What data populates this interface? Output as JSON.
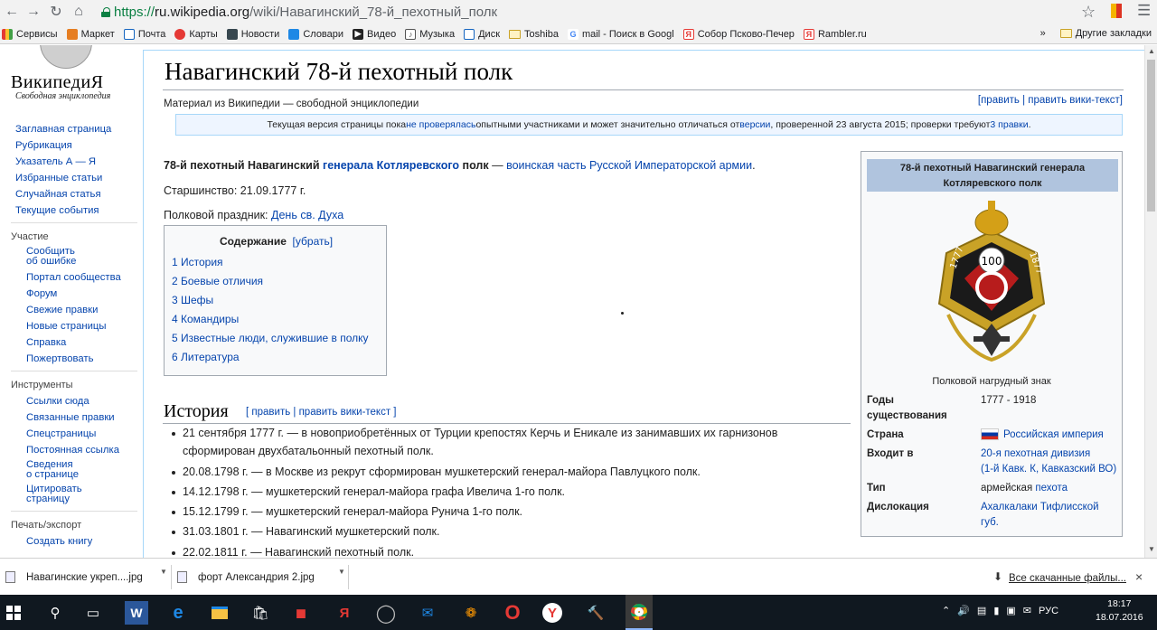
{
  "browser": {
    "url_scheme": "https://",
    "url_host": "ru.wikipedia.org",
    "url_path": "/wiki/Навагинский_78-й_пехотный_полк"
  },
  "bookmarks": {
    "items": [
      "Сервисы",
      "Маркет",
      "Почта",
      "Карты",
      "Новости",
      "Словари",
      "Видео",
      "Музыка",
      "Диск",
      "Toshiba",
      "mail - Поиск в Googl",
      "Собор Псково-Печер",
      "Rambler.ru"
    ],
    "overflow": "»",
    "other": "Другие закладки"
  },
  "wiki": {
    "wordmark": "ВикипедиЯ",
    "tagline": "Свободная энциклопедия"
  },
  "sidebar": {
    "nav": [
      "Заглавная страница",
      "Рубрикация",
      "Указатель А — Я",
      "Избранные статьи",
      "Случайная статья",
      "Текущие события"
    ],
    "participation_head": "Участие",
    "participation": [
      "Сообщить",
      "об ошибке",
      "Портал сообщества",
      "Форум",
      "Свежие правки",
      "Новые страницы",
      "Справка",
      "Пожертвовать"
    ],
    "tools_head": "Инструменты",
    "tools": [
      "Ссылки сюда",
      "Связанные правки",
      "Спецстраницы",
      "Постоянная ссылка",
      "Сведения",
      "о странице",
      "Цитировать",
      "страницу"
    ],
    "print_head": "Печать/экспорт",
    "print": [
      "Создать книгу"
    ]
  },
  "article": {
    "title": "Навагинский 78-й пехотный полк",
    "subtitle": "Материал из Википедии — свободной энциклопедии",
    "edit": "[править | править вики-текст]",
    "notice_a": "Текущая версия страницы пока ",
    "notice_link1": "не проверялась",
    "notice_b": " опытными участниками и может значительно отличаться от ",
    "notice_link2": "версии",
    "notice_c": ", проверенной 23 августа 2015; проверки требуют ",
    "notice_link3": "3 правки",
    "notice_d": ".",
    "lead_bold1": "78-й пехотный Навагинский ",
    "lead_link_bold": "генерала Котляревского",
    "lead_bold2": " полк",
    "lead_dash": " — ",
    "lead_link": "воинская часть Русской Императорской армии",
    "lead_end": ".",
    "seniority": "Старшинство: 21.09.1777 г.",
    "holiday_label": "Полковой праздник: ",
    "holiday_link": "День св. Духа",
    "toc_title": "Содержание",
    "toc_toggle": "[убрать]",
    "toc": [
      "1 История",
      "2 Боевые отличия",
      "3 Шефы",
      "4 Командиры",
      "5 Известные люди, служившие в полку",
      "6 Литература"
    ],
    "history_heading": "История",
    "history_edit": "[ править | править вики-текст ]",
    "history": [
      "21 сентября 1777 г. — в новоприобретённых от Турции крепостях Керчь и Еникале из занимавших их гарнизонов",
      "сформирован двухбатальонный пехотный полк.",
      "20.08.1798 г. — в Москве из рекрут сформирован мушкетерский генерал-майора Павлуцкого полк.",
      "14.12.1798 г. — мушкетерский генерал-майора графа Ивелича 1-го полк.",
      "15.12.1799 г. — мушкетерский генерал-майора Рунича 1-го полк.",
      "31.03.1801 г. — Навагинский мушкетерский полк.",
      "22.02.1811 г. — Навагинский пехотный полк."
    ]
  },
  "infobox": {
    "title": "78-й пехотный Навагинский генерала Котляревского полк",
    "badge_year_left": "1777",
    "badge_year_right": "1877",
    "badge_number": "100",
    "caption": "Полковой нагрудный знак",
    "years_label": "Годы существования",
    "years": "1777 - 1918",
    "country_label": "Страна",
    "country": "Российская империя",
    "part_label": "Входит в",
    "part1": "20-я пехотная дивизия",
    "part2": "(1-й Кавк. К, Кавказский ВО)",
    "type_label": "Тип",
    "type_a": "армейская ",
    "type_link": "пехота",
    "location_label": "Дислокация",
    "location": "Ахалкалаки Тифлисской губ."
  },
  "downloads": {
    "items": [
      "Навагинские  укреп....jpg",
      "форт  Александрия  2.jpg"
    ],
    "all": "Все скачанные файлы...",
    "close": "×"
  },
  "taskbar": {
    "lang": "РУС",
    "time": "18:17",
    "date": "18.07.2016"
  },
  "colors": {
    "link": "#0645ad",
    "infobox_header": "#b0c4de",
    "taskbar": "#101820"
  }
}
